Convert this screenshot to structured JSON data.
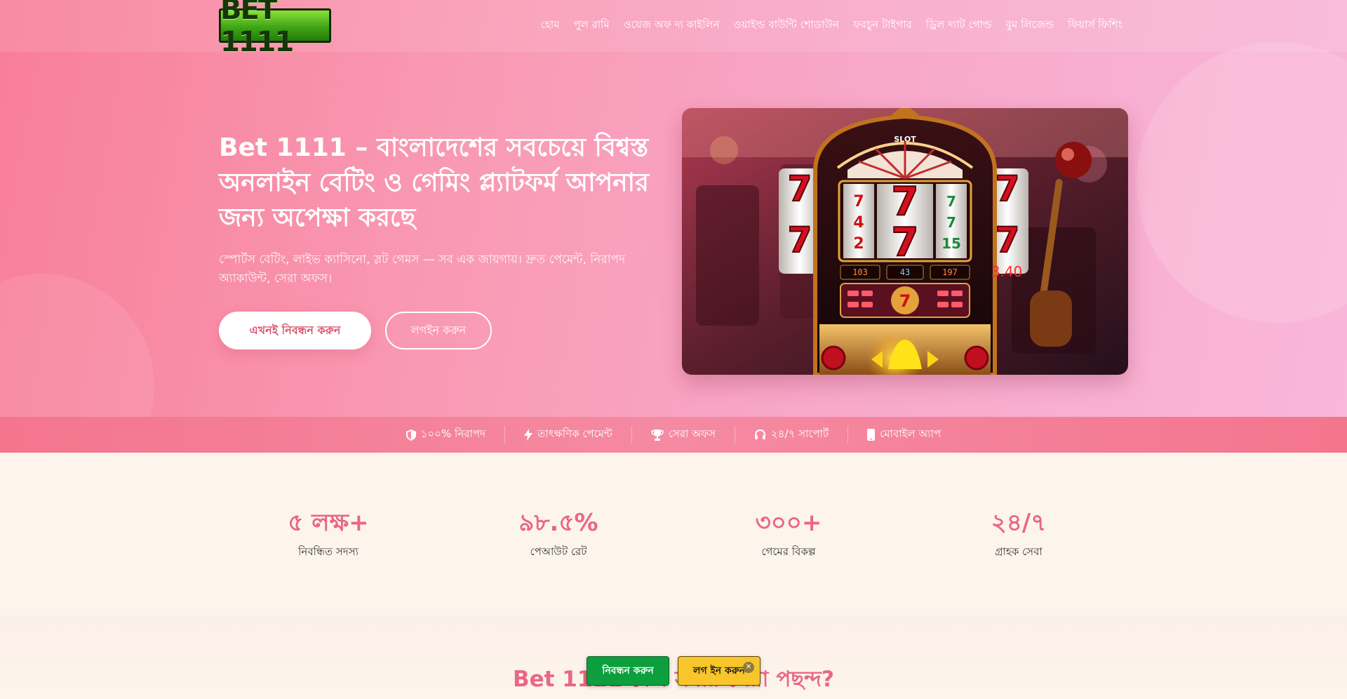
{
  "header": {
    "logo_text": "BET 1111",
    "nav": [
      "হোম",
      "পুল রামি",
      "ওয়েজ অফ দ্য কাইলিন",
      "ওয়াইল্ড বাউন্টি শোডাউন",
      "ফরচুন টাইগার",
      "ড্রিল দ্যাট গোল্ড",
      "বুম লিজেন্ড",
      "ফিয়ার্স ফিশিং"
    ]
  },
  "hero": {
    "title": "Bet 1111 – বাংলাদেশের সবচেয়ে বিশ্বস্ত অনলাইন বেটিং ও গেমিং প্ল্যাটফর্ম আপনার জন্য অপেক্ষা করছে",
    "subtitle": "স্পোর্টস বেটিং, লাইভ ক্যাসিনো, স্লট গেমস — সব এক জায়গায়। দ্রুত পেমেন্ট, নিরাপদ অ্যাকাউন্ট, সেরা অফস।",
    "primary_button": "এখনই নিবন্ধন করুন",
    "secondary_button": "লগইন করুন",
    "image_texts": {
      "machine_top": "SLOT",
      "credit_1": "103",
      "credit_2": "43",
      "credit_3": "197",
      "side_reading": "3.40"
    }
  },
  "features": [
    {
      "icon": "shield-icon",
      "label": "১০০% নিরাপদ"
    },
    {
      "icon": "bolt-icon",
      "label": "তাৎক্ষণিক পেমেন্ট"
    },
    {
      "icon": "trophy-icon",
      "label": "সেরা অফস"
    },
    {
      "icon": "headset-icon",
      "label": "২৪/৭ সাপোর্ট"
    },
    {
      "icon": "mobile-icon",
      "label": "মোবাইল অ্যাপ"
    }
  ],
  "stats": [
    {
      "value": "৫ লক্ষ+",
      "label": "নিবন্ধিত সদস্য"
    },
    {
      "value": "৯৮.৫%",
      "label": "পেআউট রেট"
    },
    {
      "value": "৩০০+",
      "label": "গেমের বিকল্প"
    },
    {
      "value": "২৪/৭",
      "label": "গ্রাহক সেবা"
    }
  ],
  "section": {
    "title": "Bet 1111 কেন সবার সেরা পছন্দ?"
  },
  "sticky": {
    "register": "নিবন্ধন করুন",
    "login": "লগ ইন করুন",
    "close": "✕"
  },
  "colors": {
    "accent": "#ea6783",
    "hero_start": "#f87e98",
    "hero_end": "#f9b7d9",
    "register_green": "#0d9f3d",
    "login_yellow": "#f8c52a"
  }
}
